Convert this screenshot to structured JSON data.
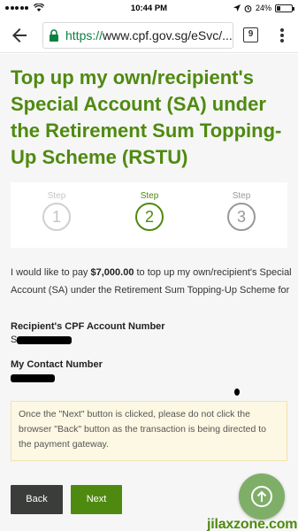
{
  "status_bar": {
    "time": "10:44 PM",
    "battery": "24%",
    "battery_level": 0.24
  },
  "browser": {
    "url_scheme": "https://",
    "url_rest": "www.cpf.gov.sg/eSvc/...",
    "tab_count": "9"
  },
  "page": {
    "title": "Top up my own/recipient's Special Account (SA) under the Retirement Sum Topping-Up Scheme (RSTU)",
    "steps": [
      {
        "label": "Step",
        "number": "1"
      },
      {
        "label": "Step",
        "number": "2"
      },
      {
        "label": "Step",
        "number": "3"
      }
    ],
    "active_step": 2,
    "body": {
      "prefix": "I would like to pay ",
      "amount": "$7,000.00",
      "suffix": " to top up my own/recipient's Special Account (SA) under the Retirement Sum Topping-Up Scheme for"
    },
    "recipient_label": "Recipient's CPF Account Number",
    "recipient_value_prefix": "S",
    "contact_label": "My Contact Number",
    "notice": "Once the \"Next\" button is clicked, please do not click the browser \"Back\" button as the transaction is being directed to the payment gateway.",
    "back_label": "Back",
    "next_label": "Next"
  },
  "watermark": "jilaxzone.com",
  "colors": {
    "accent": "#4f8a10",
    "notice_bg": "#fcf8e3",
    "back_button": "#3b3d3b",
    "fab": "#7fae68"
  },
  "icons": {
    "back": "back-arrow-icon",
    "lock": "lock-icon",
    "menu": "more-vert-icon",
    "fab": "arrow-up-icon"
  }
}
